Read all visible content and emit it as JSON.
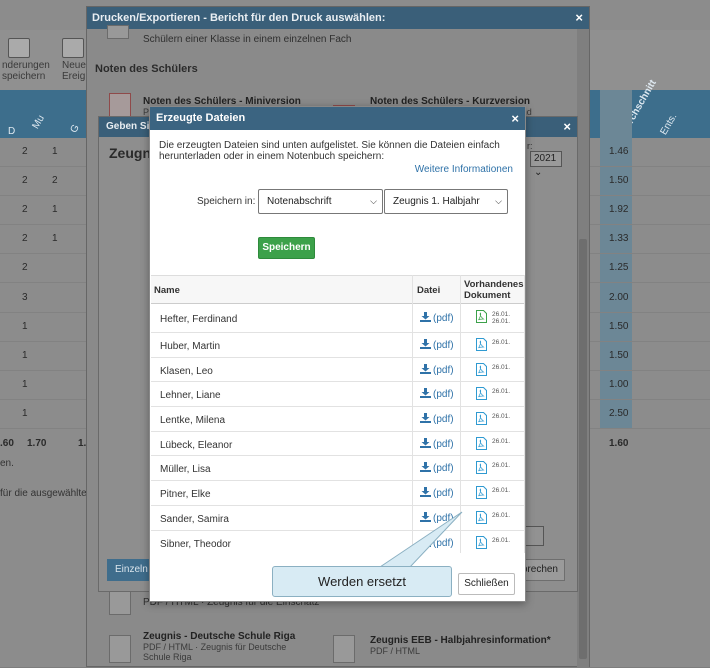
{
  "background": {
    "toolbar": [
      {
        "label_line1": "nderungen",
        "label_line2": "speichern"
      },
      {
        "label_line1": "Neue",
        "label_line2": "Ereig"
      }
    ],
    "columns": [
      "D",
      "Mu",
      "G",
      "Durchschnitt",
      "Ents."
    ],
    "rows": [
      {
        "a": "2",
        "b": "1",
        "avg": "1.46"
      },
      {
        "a": "2",
        "b": "2",
        "avg": "1.50"
      },
      {
        "a": "2",
        "b": "1",
        "avg": "1.92"
      },
      {
        "a": "2",
        "b": "1",
        "avg": "1.33"
      },
      {
        "a": "2",
        "b": "",
        "avg": "1.25"
      },
      {
        "a": "3",
        "b": "",
        "avg": "2.00"
      },
      {
        "a": "1",
        "b": "",
        "avg": "1.50"
      },
      {
        "a": "1",
        "b": "",
        "avg": "1.50"
      },
      {
        "a": "1",
        "b": "",
        "avg": "1.00"
      },
      {
        "a": "1",
        "b": "",
        "avg": "2.50"
      }
    ],
    "footer": {
      "c1": ".60",
      "c2": "1.70",
      "c3": "1.",
      "avg": "1.60"
    },
    "notes": [
      "en.",
      "für die ausgewählte K"
    ]
  },
  "export_dialog": {
    "title": "Drucken/Exportieren - Bericht für den Druck auswählen:",
    "top_item_sub": "Schülern einer Klasse in einem einzelnen Fach",
    "section": "Noten des Schülers",
    "items": [
      {
        "title": "Noten des Schülers - Miniversion",
        "sub": "P"
      },
      {
        "title": "Noten des Schülers - Kurzversion",
        "sub": "PDF / HTML · Bericht mit den Noten und"
      },
      {
        "title": "Zeugnis - Deutsche Schule Riga",
        "sub": "PDF / HTML · Zeugnis für Deutsche Schule Riga"
      },
      {
        "title": "Zeugnis EEB - Halbjahresinformation*",
        "sub": "PDF / HTML"
      }
    ],
    "hidden_sub": "PDF / HTML · Zeugnis für die Einschätz"
  },
  "zeugnis_dialog": {
    "title": "Geben Sie",
    "heading": "Zeugni",
    "select_value": "2021",
    "label_r": "r:",
    "left_button": "Einzeln",
    "right_button": "brechen"
  },
  "files_dialog": {
    "title": "Erzeugte Dateien",
    "description": "Die erzeugten Dateien sind unten aufgelistet. Sie können die Dateien einfach herunterladen oder in einem Notenbuch speichern:",
    "more_link": "Weitere Informationen",
    "save_in_label": "Speichern in:",
    "select_book": "Notenabschrift",
    "select_period": "Zeugnis 1. Halbjahr",
    "save_button": "Speichern",
    "columns": {
      "name": "Name",
      "file": "Datei",
      "existing_line1": "Vorhandenes",
      "existing_line2": "Dokument"
    },
    "download_label": "(pdf)",
    "rows": [
      {
        "name": "Hefter, Ferdinand",
        "dates": [
          "26.01.",
          "26.01."
        ]
      },
      {
        "name": "Huber, Martin",
        "dates": [
          "26.01."
        ]
      },
      {
        "name": "Klasen, Leo",
        "dates": [
          "26.01."
        ]
      },
      {
        "name": "Lehner, Liane",
        "dates": [
          "26.01."
        ]
      },
      {
        "name": "Lentke, Milena",
        "dates": [
          "26.01."
        ]
      },
      {
        "name": "Lübeck, Eleanor",
        "dates": [
          "26.01."
        ]
      },
      {
        "name": "Müller, Lisa",
        "dates": [
          "26.01."
        ]
      },
      {
        "name": "Pitner, Elke",
        "dates": [
          "26.01."
        ]
      },
      {
        "name": "Sander, Samira",
        "dates": [
          "26.01."
        ]
      },
      {
        "name": "Sibner, Theodor",
        "dates": [
          "26.01."
        ]
      }
    ],
    "close_button": "Schließen"
  },
  "callout": {
    "text": "Werden ersetzt"
  },
  "colors": {
    "accent": "#3b6481",
    "save_green": "#3ca14a",
    "link": "#2f72a8",
    "doc_icon": "#2f9ad1",
    "doc_icon_first": "#3ca14a"
  }
}
